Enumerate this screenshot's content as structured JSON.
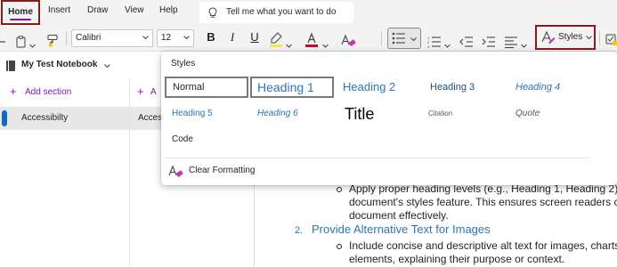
{
  "tabs": {
    "home": "Home",
    "insert": "Insert",
    "draw": "Draw",
    "view": "View",
    "help": "Help"
  },
  "tell_me": {
    "text": "Tell me what you want to do"
  },
  "ribbon": {
    "font_name": "Calibri",
    "font_size": "12",
    "bold": "B",
    "italic": "I",
    "underline": "U",
    "styles_label": "Styles",
    "highlight_color": "#f5e642",
    "font_color": "#c50f1f"
  },
  "nav": {
    "notebook_title": "My Test Notebook",
    "add_section": "Add section",
    "add_page_truncated": "A",
    "section_item": "Accessibilty",
    "page_item_truncated": "Access"
  },
  "content": {
    "bold_fragment": "bility",
    "bullet1_line1": "Apply proper heading levels (e.g., Heading 1, Heading 2) u",
    "bullet1_line2": "document's styles feature. This ensures screen readers ca",
    "bullet1_line3": "document effectively.",
    "item2_number": "2.",
    "item2_heading": "Provide Alternative Text for Images",
    "bullet2_line1": "Include concise and descriptive alt text for images, charts,",
    "bullet2_line2": "elements, explaining their purpose or context."
  },
  "styles_popup": {
    "title": "Styles",
    "items": {
      "normal": "Normal",
      "heading1": "Heading 1",
      "heading2": "Heading 2",
      "heading3": "Heading 3",
      "heading4": "Heading 4",
      "heading5": "Heading 5",
      "heading6": "Heading 6",
      "title": "Title",
      "citation": "Citation",
      "quote": "Quote",
      "code": "Code"
    },
    "clear_formatting": "Clear Formatting"
  },
  "colors": {
    "accent": "#7719aa",
    "callout_border": "#8b1a1a",
    "heading_blue": "#2e74b5",
    "section_marker": "#0f6cbd"
  }
}
